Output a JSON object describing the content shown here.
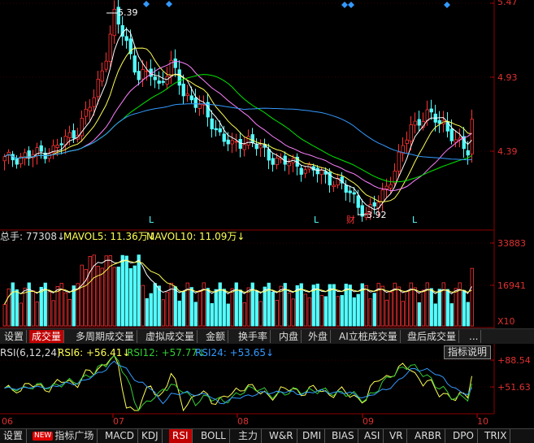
{
  "price_axis": {
    "labels": [
      "5.47",
      "4.93",
      "4.39"
    ]
  },
  "annotations": {
    "high": "5.39",
    "low": "3.92",
    "l_markers": [
      "L",
      "L",
      "L"
    ],
    "cai_marker": "财"
  },
  "volume_header": {
    "total": "总手: 77308↓",
    "mavol5": "MAVOL5: 11.36万↓",
    "mavol10": "MAVOL10: 11.09万↓"
  },
  "volume_axis": {
    "labels": [
      "33883",
      "16941",
      "X10"
    ]
  },
  "indicator_tabs": {
    "settings": "设置",
    "items": [
      "成交量",
      "多周期成交量",
      "虚拟成交量",
      "金额",
      "换手率",
      "内盘",
      "外盘",
      "AI立桩成交量",
      "盘后成交量"
    ],
    "more": "..."
  },
  "rsi_header": {
    "name": "RSI(6,12,24)",
    "rsi6": "RSI6: +56.41↓",
    "rsi12": "RSI12: +57.77↓",
    "rsi24": "RSI24: +53.65↓"
  },
  "rsi_axis": {
    "labels": [
      "+88.54",
      "+51.63"
    ]
  },
  "help_button": "指标说明",
  "time_axis": {
    "labels": [
      "06",
      "07",
      "08",
      "09",
      "10"
    ]
  },
  "bottom_tabs": {
    "settings": "设置",
    "new_badge": "NEW",
    "items": [
      "指标广场",
      "MACD",
      "KDJ",
      "RSI",
      "BOLL",
      "主力",
      "W&R",
      "DMI",
      "BIAS",
      "ASI",
      "VR",
      "ARBR",
      "DPO",
      "TRIX"
    ]
  },
  "colors": {
    "up": "#ff3232",
    "down": "#54ffff",
    "ma5": "#ffffff",
    "ma10": "#ffff54",
    "ma20": "#ff80ff",
    "ma30": "#00e600",
    "ma60": "#3399ff",
    "axis": "#c00000"
  },
  "chart_data": {
    "type": "candlestick",
    "price_ylim": [
      3.85,
      5.47
    ],
    "price_ticks": [
      5.47,
      4.93,
      4.39
    ],
    "high_label": 5.39,
    "low_label": 3.92,
    "volume_ticks": [
      33883,
      16941
    ],
    "rsi_ticks": [
      88.54,
      51.63
    ],
    "rsi": {
      "rsi6": 56.41,
      "rsi12": 57.77,
      "rsi24": 53.65
    },
    "months": [
      "06",
      "07",
      "08",
      "09",
      "10"
    ]
  }
}
